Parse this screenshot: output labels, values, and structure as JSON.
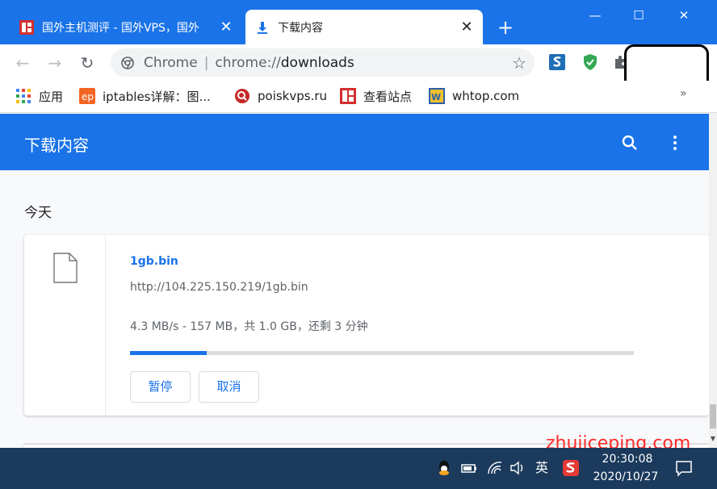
{
  "tabs": [
    {
      "title": "国外主机测评 - 国外VPS，国外",
      "close": "✕",
      "active": false
    },
    {
      "title": "下载内容",
      "close": "✕",
      "active": true
    }
  ],
  "new_tab_label": "+",
  "window_controls": {
    "minimize": "—",
    "maximize": "☐",
    "close": "✕"
  },
  "toolbar": {
    "back": "←",
    "forward": "→",
    "reload": "↻",
    "site": "Chrome",
    "separator": "|",
    "url_scheme": "chrome://",
    "url_path": "downloads",
    "star": "☆"
  },
  "bookmarks": [
    {
      "label": "应用",
      "icon": "apps-grid-icon"
    },
    {
      "label": "iptables详解：图...",
      "icon": "ep-logo-icon"
    },
    {
      "label": "poiskvps.ru",
      "icon": "poiskvps-icon"
    },
    {
      "label": "查看站点",
      "icon": "site-red-icon"
    },
    {
      "label": "whtop.com",
      "icon": "whtop-icon"
    }
  ],
  "bookmarks_more": "»",
  "downloads": {
    "page_title": "下载内容",
    "section_date": "今天",
    "item": {
      "file_name": "1gb.bin",
      "url": "http://104.225.150.219/1gb.bin",
      "status": "4.3 MB/s - 157 MB，共 1.0 GB，还剩 3 分钟",
      "progress_percent": 15.3,
      "pause_label": "暂停",
      "cancel_label": "取消"
    }
  },
  "watermark": "zhujiceping.com",
  "taskbar": {
    "ime": "英",
    "time": "20:30:08",
    "date": "2020/10/27"
  },
  "colors": {
    "accent": "#1a73e8",
    "taskbar": "#1b3a5c",
    "watermark": "#ff2a2a"
  }
}
